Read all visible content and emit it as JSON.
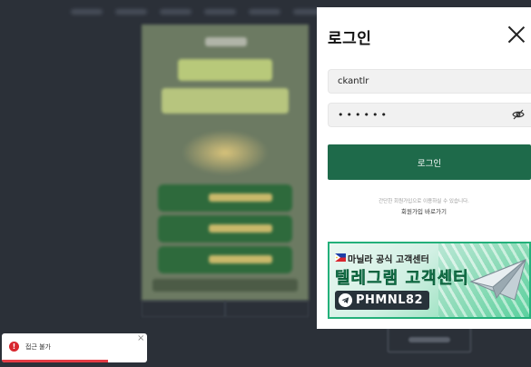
{
  "login": {
    "title": "로그인",
    "username_value": "ckantlr",
    "password_value": "••••••",
    "submit_label": "로그인",
    "hint": "간단한 회원가입으로 이용하실 수 있습니다.",
    "signup_link": "회원가입 바로가기"
  },
  "banner": {
    "line1": "마닐라 공식 고객센터",
    "line2": "텔레그램 고객센터",
    "telegram_id": "PHMNL82"
  },
  "toast": {
    "message": "접근 불가",
    "close_label": "×",
    "progress": 0.73
  },
  "colors": {
    "primary": "#1e6a4a",
    "error": "#d8262e",
    "backdrop": "#2b3038"
  }
}
